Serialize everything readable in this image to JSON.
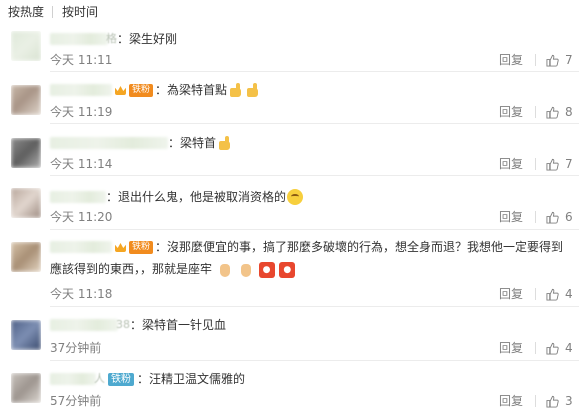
{
  "tabs": [
    {
      "label": "按热度"
    },
    {
      "label": "按时间"
    }
  ],
  "reply_label": "回复",
  "comments": [
    {
      "nick_tail": "格",
      "text": "：梁生好刚",
      "time": "今天 11:11",
      "likes": "7"
    },
    {
      "badge_fans": "铁粉",
      "text": "：為梁特首點",
      "time": "今天 11:19",
      "likes": "8"
    },
    {
      "text": "：梁特首",
      "time": "今天 11:14",
      "likes": "7"
    },
    {
      "text": "：退出什么鬼，他是被取消资格的",
      "time": "今天 11:20",
      "likes": "6"
    },
    {
      "badge_fans": "铁粉",
      "text": "：沒那麼便宜的事，搞了那麼多破壞的行為，想全身而退？我想他一定要得到",
      "text2": "應該得到的東西，，那就是座牢",
      "time": "今天 11:18",
      "likes": "4"
    },
    {
      "nick_tail": "38",
      "text": "：梁特首一针见血",
      "time": "37分钟前",
      "likes": "4"
    },
    {
      "nick_tail": "人",
      "badge_tiefen": "铁粉",
      "text": "：汪精卫温文儒雅的",
      "time": "57分钟前",
      "likes": "3"
    }
  ],
  "icons": {
    "like": "thumbs-up-outline-icon",
    "crown": "crown-icon",
    "emoji_thumb": "thumbs-up-emoji",
    "emoji_face": "embarrassed-face-emoji",
    "emoji_hand": "ok-hand-emoji",
    "emoji_lion": "lion-dance-emoji"
  },
  "colors": {
    "text": "#333333",
    "muted": "#808080",
    "fans_badge": "#f18b1e",
    "tiefen_badge": "#4ea9cf",
    "divider": "#ececec"
  }
}
